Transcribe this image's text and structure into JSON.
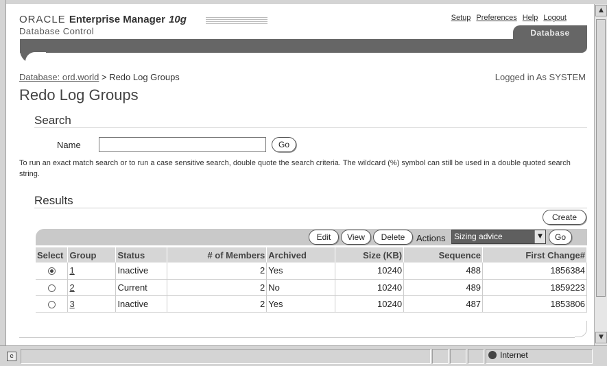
{
  "header": {
    "brand": "ORACLE",
    "product": "Enterprise Manager",
    "version": "10g",
    "subtitle": "Database Control",
    "links": [
      "Setup",
      "Preferences",
      "Help",
      "Logout"
    ],
    "tab": "Database"
  },
  "breadcrumb": {
    "link": "Database: ord.world",
    "separator": ">",
    "current": "Redo Log Groups"
  },
  "logged_in": "Logged in As SYSTEM",
  "page_title": "Redo Log Groups",
  "search": {
    "heading": "Search",
    "name_label": "Name",
    "name_value": "",
    "go_label": "Go",
    "hint": "To run an exact match search or to run a case sensitive search, double quote the search criteria. The wildcard (%) symbol can still be used in a double quoted search string."
  },
  "results": {
    "heading": "Results",
    "create_label": "Create",
    "toolbar": {
      "edit_label": "Edit",
      "view_label": "View",
      "delete_label": "Delete",
      "actions_label": "Actions",
      "actions_selected": "Sizing advice",
      "go_label": "Go"
    },
    "columns": [
      "Select",
      "Group",
      "Status",
      "# of Members",
      "Archived",
      "Size (KB)",
      "Sequence",
      "First Change#"
    ],
    "rows": [
      {
        "selected": true,
        "group": "1",
        "status": "Inactive",
        "members": "2",
        "archived": "Yes",
        "size_kb": "10240",
        "sequence": "488",
        "first_change": "1856384"
      },
      {
        "selected": false,
        "group": "2",
        "status": "Current",
        "members": "2",
        "archived": "No",
        "size_kb": "10240",
        "sequence": "489",
        "first_change": "1859223"
      },
      {
        "selected": false,
        "group": "3",
        "status": "Inactive",
        "members": "2",
        "archived": "Yes",
        "size_kb": "10240",
        "sequence": "487",
        "first_change": "1853806"
      }
    ]
  },
  "statusbar": {
    "zone": "Internet",
    "page_icon": "page-icon",
    "zone_icon": "globe-icon"
  }
}
